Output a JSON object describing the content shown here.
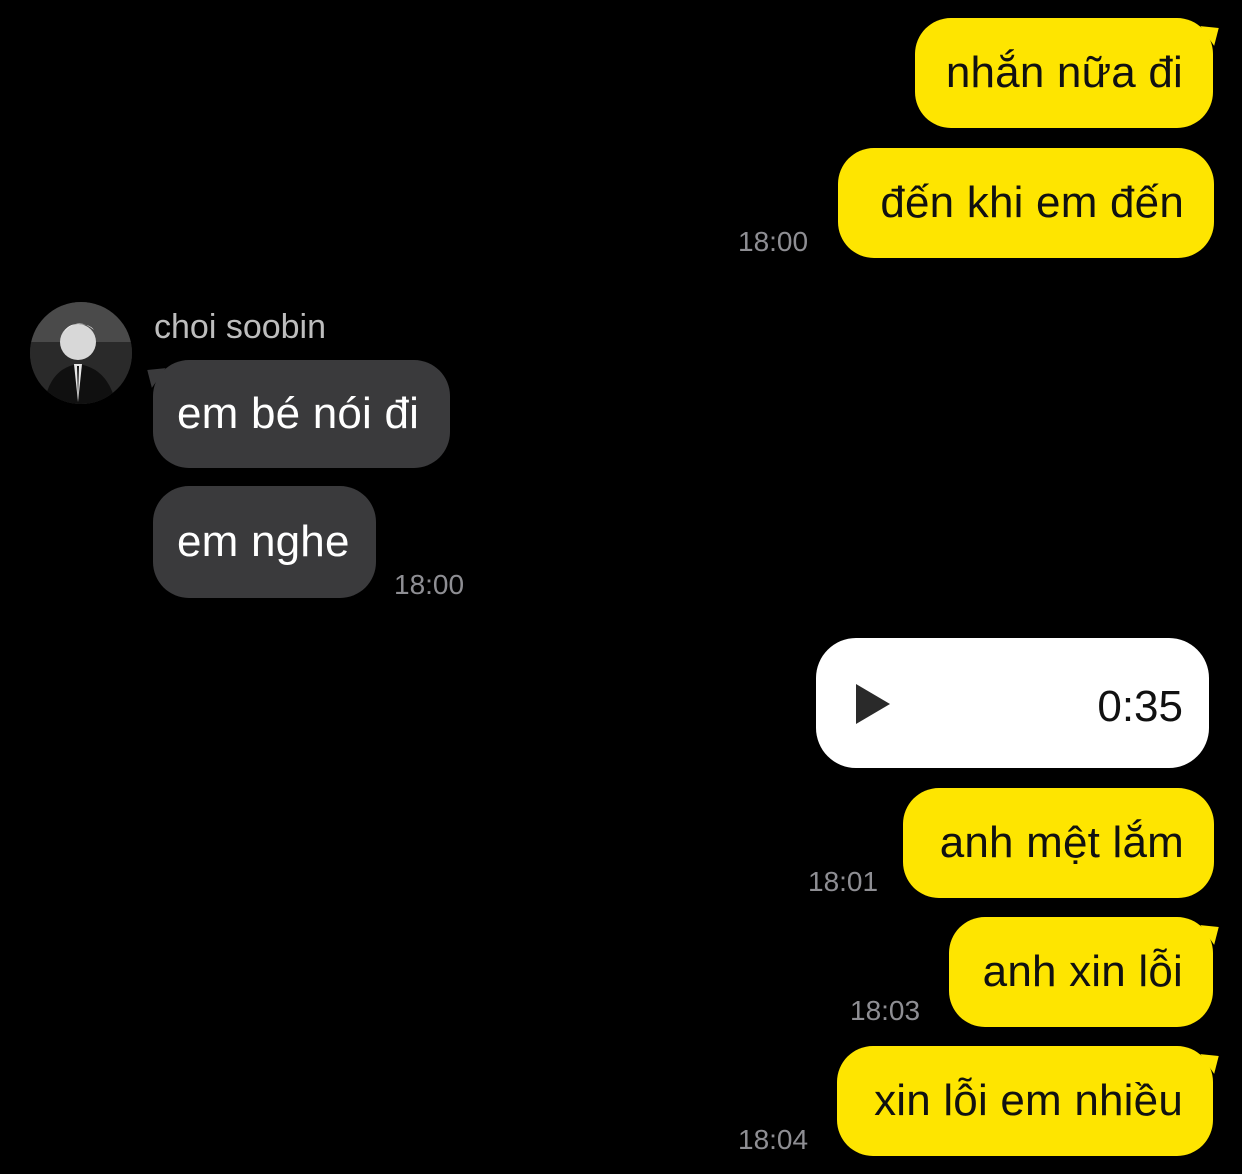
{
  "messages": {
    "m1": {
      "text": "nhắn nữa đi"
    },
    "m2": {
      "text": "đến khi em đến",
      "time": "18:00"
    },
    "m3": {
      "sender": "choi soobin",
      "text": "em bé nói đi"
    },
    "m4": {
      "text": "em nghe",
      "time": "18:00"
    },
    "m5": {
      "voice_duration": "0:35",
      "icon": "play-icon"
    },
    "m6": {
      "text": "anh mệt lắm",
      "time": "18:01"
    },
    "m7": {
      "text": "anh xin lỗi",
      "time": "18:03"
    },
    "m8": {
      "text": "xin lỗi em nhiều",
      "time": "18:04"
    }
  },
  "colors": {
    "background": "#000000",
    "my_bubble": "#FEE500",
    "their_bubble": "#3A3A3C",
    "voice_bubble": "#FFFFFF",
    "timestamp": "#8E8E93"
  }
}
